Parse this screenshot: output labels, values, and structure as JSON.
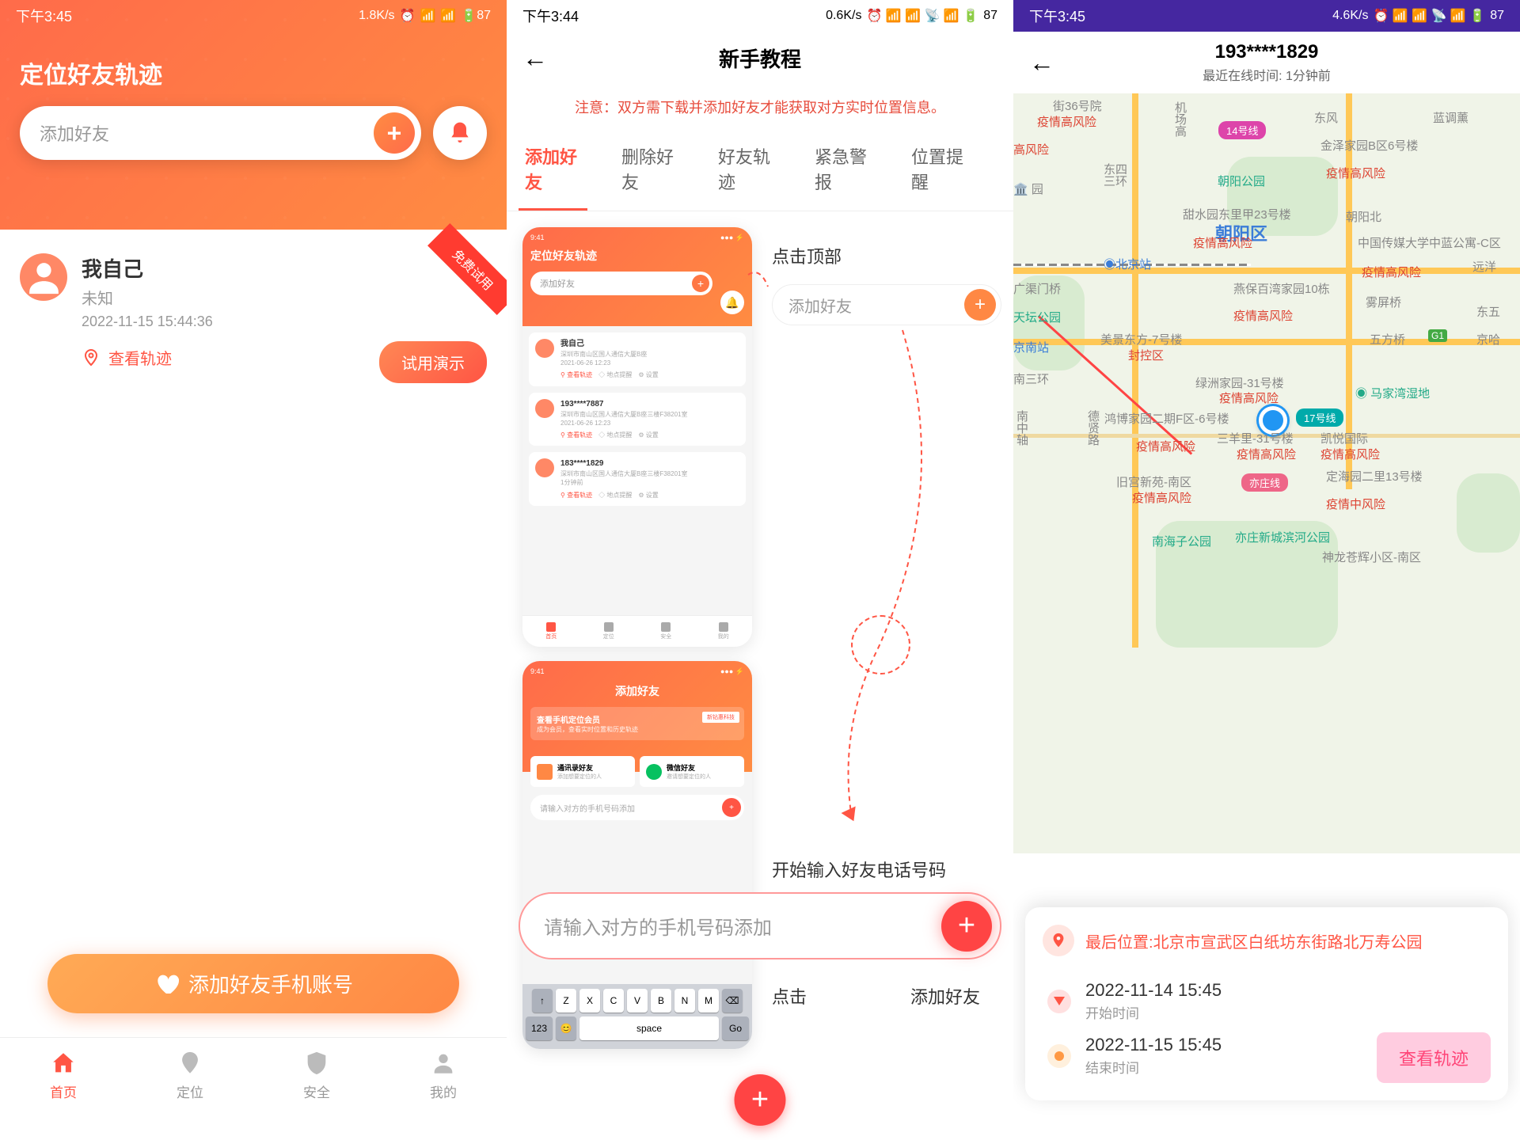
{
  "p1": {
    "status": {
      "time": "下午3:45",
      "speed": "1.8K/s",
      "battery": "87"
    },
    "title": "定位好友轨迹",
    "search_placeholder": "添加好友",
    "badge": "免费试用",
    "card": {
      "name": "我自己",
      "status": "未知",
      "date": "2022-11-15 15:44:36",
      "view_track": "查看轨迹",
      "demo": "试用演示"
    },
    "add_btn": "添加好友手机账号",
    "nav": [
      "首页",
      "定位",
      "安全",
      "我的"
    ]
  },
  "p2": {
    "status": {
      "time": "下午3:44",
      "speed": "0.6K/s",
      "battery": "87"
    },
    "title": "新手教程",
    "notice": "注意：双方需下载并添加好友才能获取对方实时位置信息。",
    "tabs": [
      "添加好友",
      "删除好友",
      "好友轨迹",
      "紧急警报",
      "位置提醒"
    ],
    "labels": {
      "click_top": "点击顶部",
      "add_friend": "添加好友",
      "enter_phone": "开始输入好友电话号码",
      "click": "点击",
      "add_friend2": "添加好友"
    },
    "search2_placeholder": "添加好友",
    "input_placeholder": "请输入对方的手机号码添加",
    "preview1": {
      "title": "定位好友轨迹",
      "search": "添加好友",
      "cards": [
        {
          "name": "我自己",
          "addr": "深圳市南山区国人通信大厦B座",
          "date": "2021-06-26  12:23"
        },
        {
          "name": "193****7887",
          "addr": "深圳市南山区国人通信大厦B座三楼F38201室",
          "date": "2021-06-26  12:23"
        },
        {
          "name": "183****1829",
          "addr": "深圳市南山区国人通信大厦B座三楼F38201室",
          "date": "1分钟前"
        }
      ],
      "actions": [
        "查看轨迹",
        "地点提醒",
        "设置"
      ],
      "nav": [
        "首页",
        "定位",
        "安全",
        "我的"
      ]
    },
    "preview2": {
      "title": "添加好友",
      "banner_title": "查看手机定位会员",
      "banner_sub": "成为会员，查看实时位置和历史轨迹",
      "banner_tag": "新钻惠科技",
      "opt1": {
        "title": "通讯录好友",
        "sub": "添加想要定位的人"
      },
      "opt2": {
        "title": "微信好友",
        "sub": "邀请想要定位的人"
      },
      "input": "请输入对方的手机号码添加"
    },
    "keyboard": {
      "row1": [
        "↑",
        "Z",
        "X",
        "C",
        "V",
        "B",
        "N",
        "M",
        "⌫"
      ],
      "row2": [
        "123",
        "😊",
        "space",
        "Go"
      ]
    }
  },
  "p3": {
    "status": {
      "time": "下午3:45",
      "speed": "4.6K/s",
      "battery": "87"
    },
    "header": {
      "title": "193****1829",
      "sub": "最近在线时间: 1分钟前"
    },
    "map_labels": {
      "chaoyang": "朝阳区",
      "beijing_station": "北京站",
      "tiantan": "天坛公园",
      "line14": "14号线",
      "line17": "17号线",
      "yizhuang": "亦庄线",
      "dongfeng": "东风",
      "jinze": "金泽家园B区6号楼",
      "jinze_risk": "疫情高风险",
      "chaoyang_park": "朝阳公园",
      "tianshui": "甜水园东里甲23号楼",
      "tianshui_risk": "疫情高风险",
      "zhongguo_media": "中国传媒大学中蓝公寓-C区",
      "zhongguo_risk": "疫情高风险",
      "guangqu": "广渠门桥",
      "yanbao": "燕保百湾家园10栋",
      "yanbao_risk": "疫情高风险",
      "jing_station": "京南站",
      "meijing": "美景东方-7号楼",
      "meijing_risk": "封控区",
      "nansan": "南三环",
      "lvzhou": "绿洲家园-31号楼",
      "lvzhou_risk": "疫情高风险",
      "hongbo": "鸿博家园二期F区-6号楼",
      "hongbo_risk": "疫情高风险",
      "sanyang": "三羊里-31号楼",
      "sanyang_risk": "疫情高风险",
      "kaiyue": "凯悦国际",
      "kaiyue_risk": "疫情高风险",
      "jiugong": "旧宫新苑-南区",
      "jiugong_risk": "疫情高风险",
      "nanhaizi": "南海子公园",
      "yizhuang_new": "亦庄新城滨河公园",
      "dinghai": "定海园二里13号楼",
      "dinghai_risk": "疫情中风险",
      "shenlong": "神龙苍辉小区-南区",
      "wuping": "雾屏桥",
      "wufang": "五方桥",
      "g1": "G1",
      "majia": "马家湾湿地",
      "lantiao": "蓝调薰",
      "chaoyang_north": "朝阳北",
      "yuanyang": "远洋",
      "dongwu": "东五",
      "ji": "机场高",
      "risk_nw": "疫情高风险",
      "road36": "街36号院",
      "gaofeng": "高风险",
      "dongsan1": "东三",
      "dongsan2": "四环"
    },
    "card": {
      "loc_label": "最后位置:",
      "loc_value": "北京市宣武区白纸坊东街路北万寿公园",
      "start_time": "2022-11-14 15:45",
      "start_label": "开始时间",
      "end_time": "2022-11-15 15:45",
      "end_label": "结束时间",
      "view_btn": "查看轨迹"
    }
  },
  "status_icons": "⏰ 📶 📶 📡 📶"
}
